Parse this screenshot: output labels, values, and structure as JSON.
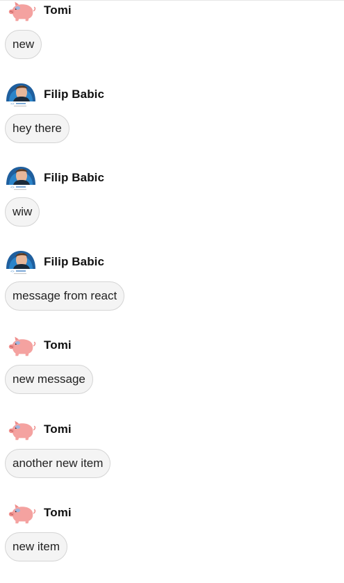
{
  "messages": [
    {
      "author": "Tomi",
      "avatar_icon": "pig-icon",
      "text": "new"
    },
    {
      "author": "Filip Babic",
      "avatar_icon": "profile-photo",
      "text": "hey there"
    },
    {
      "author": "Filip Babic",
      "avatar_icon": "profile-photo",
      "text": "wiw"
    },
    {
      "author": "Filip Babic",
      "avatar_icon": "profile-photo",
      "text": "message from react"
    },
    {
      "author": "Tomi",
      "avatar_icon": "pig-icon",
      "text": "new message"
    },
    {
      "author": "Tomi",
      "avatar_icon": "pig-icon",
      "text": "another new item"
    },
    {
      "author": "Tomi",
      "avatar_icon": "pig-icon",
      "text": "new item"
    }
  ]
}
